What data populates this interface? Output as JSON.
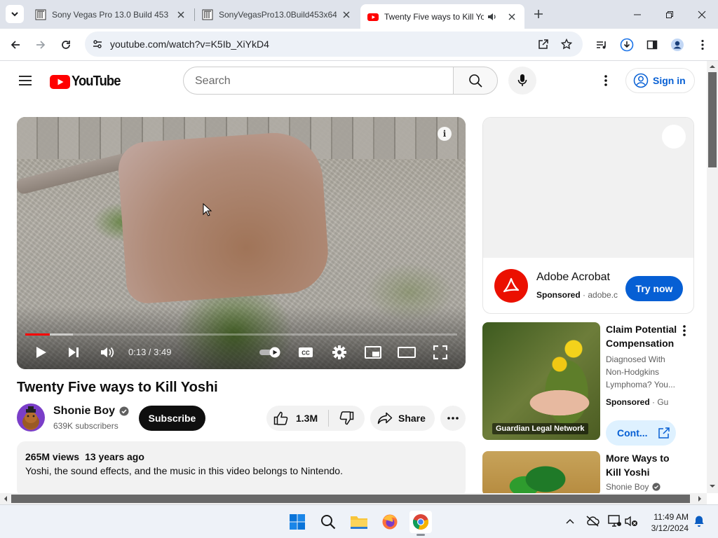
{
  "browser": {
    "tabs": [
      {
        "title": "Sony Vegas Pro 13.0 Build 453 (",
        "favicon": "archive-icon"
      },
      {
        "title": "SonyVegasPro13.0Build453x64(",
        "favicon": "archive-icon"
      },
      {
        "title": "Twenty Five ways to Kill Yoshi",
        "favicon": "youtube-icon",
        "active": true,
        "audio": true
      }
    ],
    "url": "youtube.com/watch?v=K5Ib_XiYkD4"
  },
  "youtube": {
    "logo_text": "YouTube",
    "search_placeholder": "Search",
    "sign_in_label": "Sign in"
  },
  "player": {
    "current_time": "0:13",
    "duration": "3:49",
    "time_display": "0:13 / 3:49",
    "progress_fraction": 0.057,
    "buffered_fraction": 0.11
  },
  "video": {
    "title": "Twenty Five ways to Kill Yoshi",
    "channel": "Shonie Boy",
    "subscribers": "639K subscribers",
    "subscribe_label": "Subscribe",
    "likes": "1.3M",
    "share_label": "Share",
    "views": "265M views",
    "age": "13 years ago",
    "description": "Yoshi, the sound effects, and the music in this video belongs to Nintendo."
  },
  "ad": {
    "advertiser": "Adobe Acrobat",
    "sponsored": "Sponsored",
    "domain": "adobe.c",
    "cta": "Try now",
    "brand_color": "#eb1000"
  },
  "recommendations": [
    {
      "title": "Claim Potential Compensation",
      "description": "Diagnosed With Non-Hodgkins Lymphoma? You...",
      "sponsored": "Sponsored",
      "source": "Gu",
      "thumb_label": "Guardian Legal Network",
      "cta": "Cont..."
    },
    {
      "title": "More Ways to Kill Yoshi",
      "channel": "Shonie Boy"
    }
  ],
  "taskbar": {
    "time": "11:49 AM",
    "date": "3/12/2024",
    "apps": [
      "windows-start",
      "search",
      "file-explorer",
      "firefox",
      "chrome"
    ]
  },
  "colors": {
    "yt_red": "#ff0000",
    "link_blue": "#065fd4",
    "chrome_frame": "#dfe3eb"
  }
}
